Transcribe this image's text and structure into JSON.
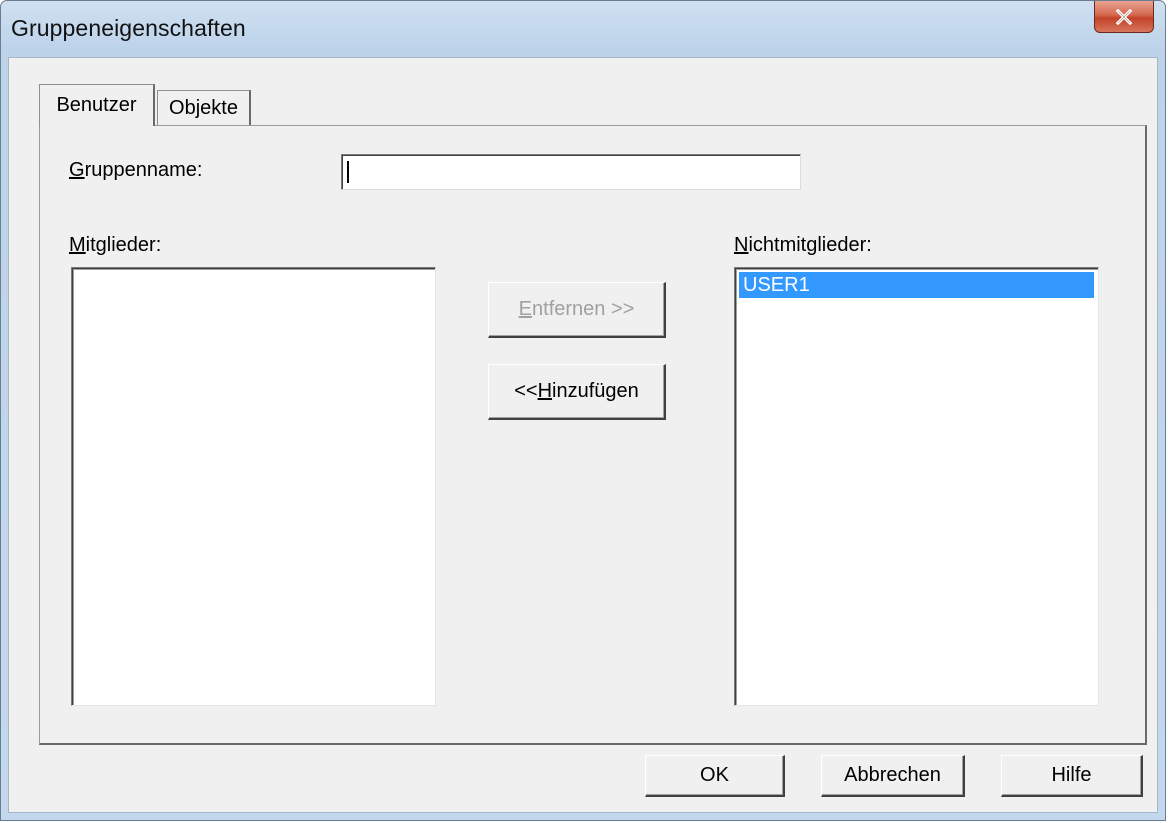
{
  "window": {
    "title": "Gruppeneigenschaften"
  },
  "tabs": [
    {
      "label": "Benutzer",
      "selected": true
    },
    {
      "label": "Objekte",
      "selected": false
    }
  ],
  "form": {
    "group_name_label_mnemonic": "G",
    "group_name_label_rest": "ruppenname:",
    "group_name_value": ""
  },
  "members": {
    "label_mnemonic": "M",
    "label_rest": "itglieder:",
    "items": []
  },
  "non_members": {
    "label_mnemonic": "N",
    "label_rest": "ichtmitglieder:",
    "items": [
      "USER1"
    ],
    "selected_index": 0
  },
  "buttons": {
    "remove_mnemonic": "E",
    "remove_rest": "ntfernen >>",
    "remove_enabled": false,
    "add_prefix": "<< ",
    "add_mnemonic": "H",
    "add_rest": "inzufügen",
    "ok": "OK",
    "cancel": "Abbrechen",
    "help": "Hilfe"
  },
  "colors": {
    "selection": "#3399ff",
    "close_button": "#c94a30",
    "dialog_background": "#f0f0f0"
  },
  "icons": {
    "close": "close-x-icon"
  }
}
